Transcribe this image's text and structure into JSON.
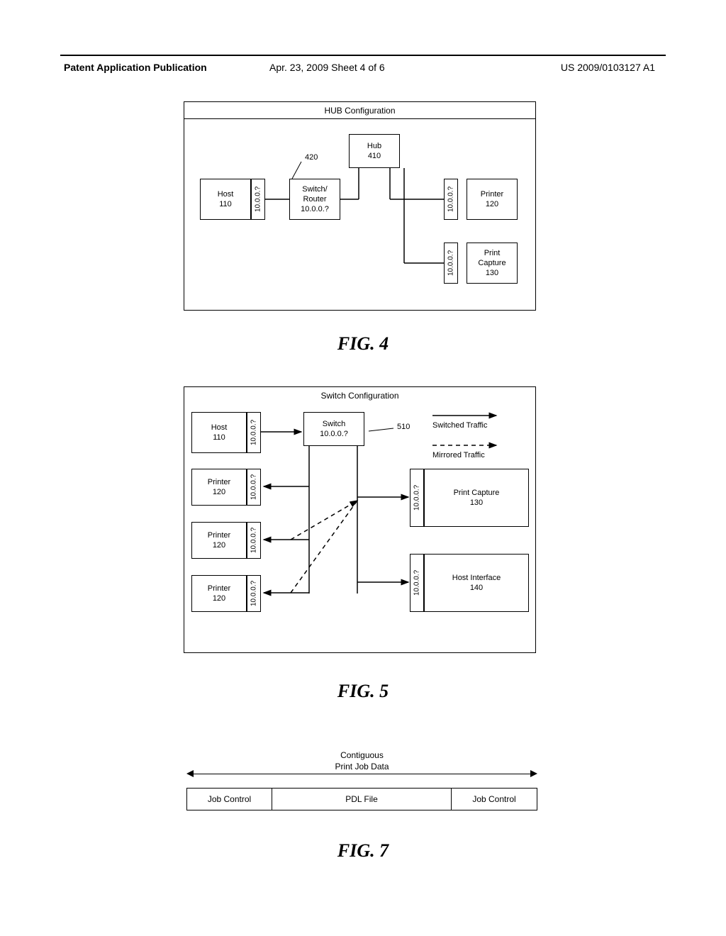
{
  "header": {
    "left": "Patent Application Publication",
    "center": "Apr. 23, 2009  Sheet 4 of 6",
    "right": "US 2009/0103127 A1"
  },
  "fig4": {
    "caption": "FIG. 4",
    "title": "HUB Configuration",
    "hub": {
      "l1": "Hub",
      "l2": "410"
    },
    "host": {
      "l1": "Host",
      "l2": "110"
    },
    "switch": {
      "l1": "Switch/",
      "l2": "Router",
      "l3": "10.0.0.?"
    },
    "printer": {
      "l1": "Printer",
      "l2": "120"
    },
    "capture": {
      "l1": "Print",
      "l2": "Capture",
      "l3": "130"
    },
    "ip": "10.0.0.?",
    "ref420": "420"
  },
  "fig5": {
    "caption": "FIG. 5",
    "title": "Switch Configuration",
    "host": {
      "l1": "Host",
      "l2": "110"
    },
    "switch": {
      "l1": "Switch",
      "l2": "10.0.0.?"
    },
    "printer": {
      "l1": "Printer",
      "l2": "120"
    },
    "capture": {
      "l1": "Print Capture",
      "l2": "130"
    },
    "hostif": {
      "l1": "Host Interface",
      "l2": "140"
    },
    "ip": "10.0.0.?",
    "ref510": "510",
    "legend_switched": "Switched Traffic",
    "legend_mirrored": "Mirrored Traffic"
  },
  "fig7": {
    "caption": "FIG. 7",
    "toplabel_l1": "Contiguous",
    "toplabel_l2": "Print Job Data",
    "c1": "Job Control",
    "c2": "PDL File",
    "c3": "Job Control"
  }
}
